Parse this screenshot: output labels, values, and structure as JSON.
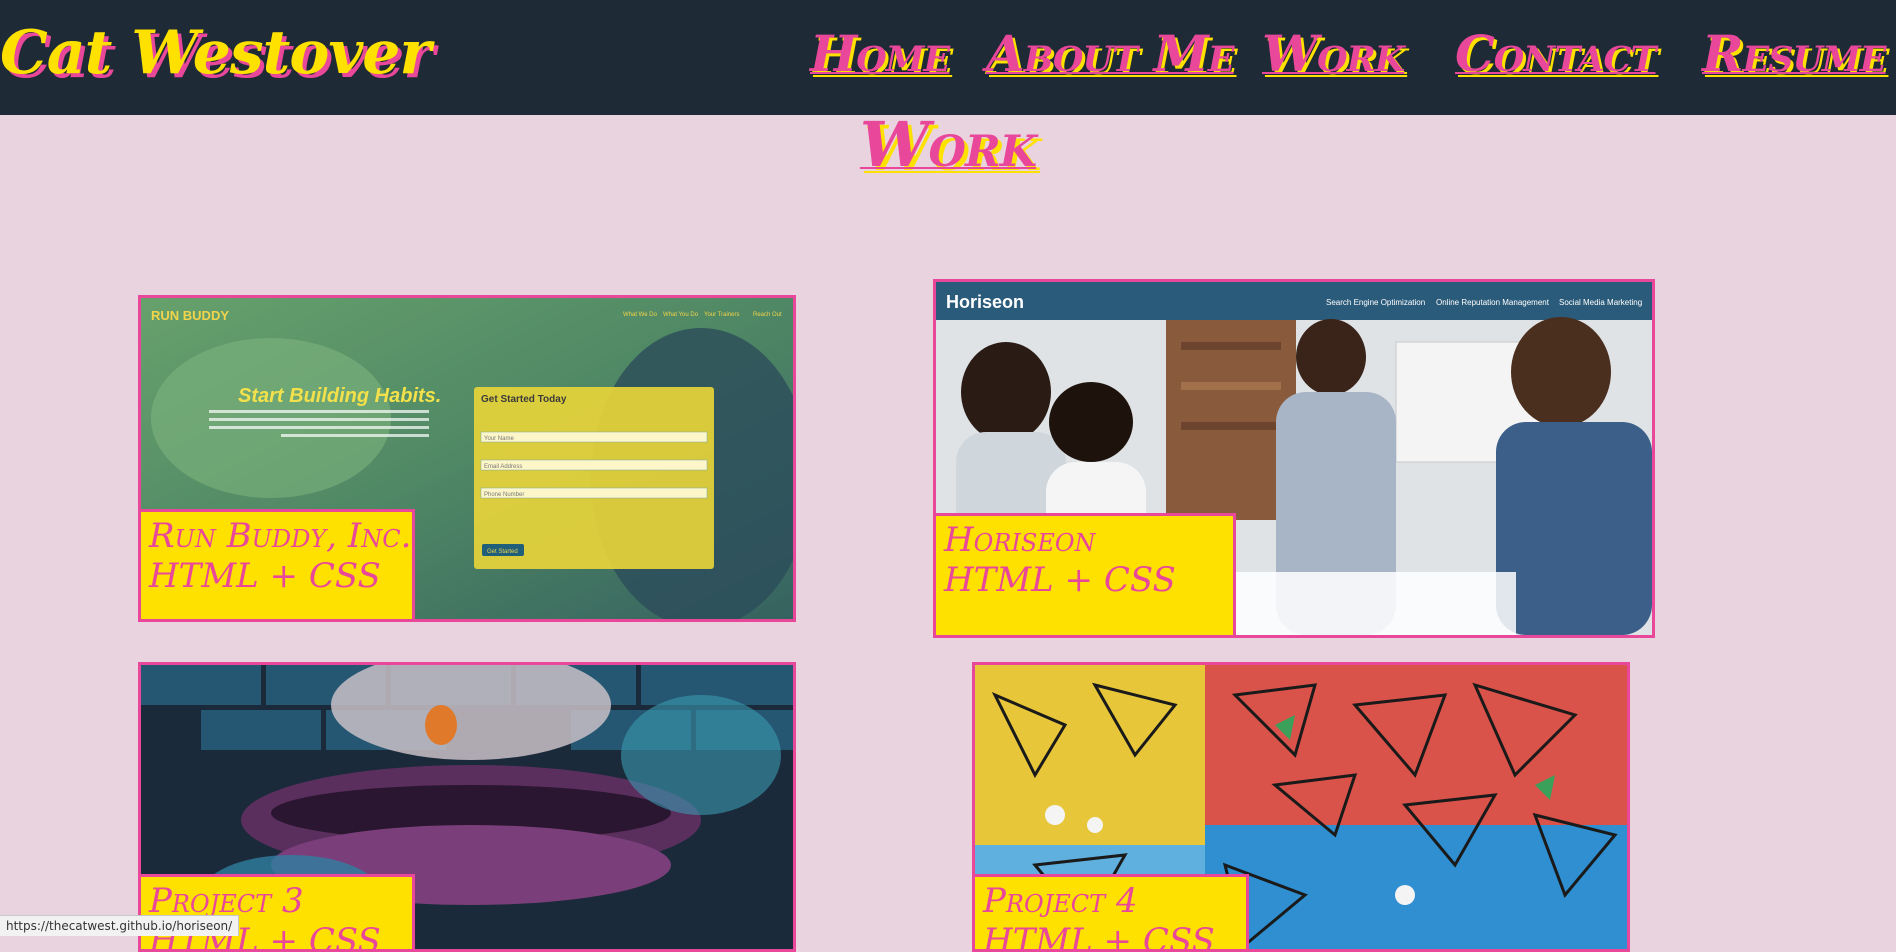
{
  "header": {
    "brand": "Cat Westover",
    "nav": [
      {
        "label": "Home"
      },
      {
        "label": "About Me"
      },
      {
        "label": "Work"
      },
      {
        "label": "Contact"
      },
      {
        "label": "Resume"
      }
    ]
  },
  "page_title": "Work",
  "projects": [
    {
      "title": "Run Buddy, Inc.",
      "tech": "HTML + CSS",
      "thumb_text": {
        "logo": "RUN BUDDY",
        "nav": [
          "What We Do",
          "What You Do",
          "Your Trainers",
          "Reach Out"
        ],
        "headline": "Start Building Habits.",
        "form_title": "Get Started Today",
        "placeholders": [
          "Your Name",
          "Email Address",
          "Phone Number"
        ],
        "button": "Get Started"
      }
    },
    {
      "title": "Horiseon",
      "tech": "HTML + CSS",
      "thumb_text": {
        "logo": "Horiseon",
        "nav": [
          "Search Engine Optimization",
          "Online Reputation Management",
          "Social Media Marketing"
        ]
      }
    },
    {
      "title": "Project 3",
      "tech": "HTML + CSS"
    },
    {
      "title": "Project 4",
      "tech": "HTML + CSS"
    }
  ],
  "status_bar": {
    "url": "https://thecatwest.github.io/horiseon/"
  },
  "colors": {
    "header_bg": "#1e2a35",
    "page_bg": "#e8d3df",
    "pink": "#e9479a",
    "yellow": "#ffe100"
  }
}
